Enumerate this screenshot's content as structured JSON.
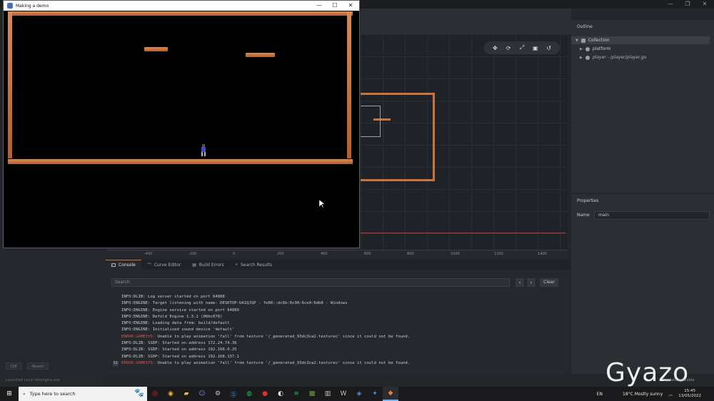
{
  "game_window": {
    "title": "Making a demo",
    "controls": {
      "minimize": "—",
      "maximize": "☐",
      "close": "✕"
    }
  },
  "editor": {
    "window_controls": {
      "minimize": "—",
      "restore": "❐",
      "close": "✕"
    },
    "scene_tools": [
      "move-tool-icon",
      "rotate-tool-icon",
      "scale-tool-icon",
      "camera-tool-icon",
      "reset-tool-icon"
    ],
    "ruler_ticks": [
      "-400",
      "-200",
      "0",
      "200",
      "400",
      "600",
      "800",
      "1000",
      "1200",
      "1400"
    ]
  },
  "outline": {
    "title": "Outline",
    "items": [
      {
        "label": "Collection",
        "depth": 0,
        "expanded": true,
        "selected": true
      },
      {
        "label": "platform",
        "depth": 1,
        "expanded": false,
        "selected": false
      },
      {
        "label": "player - /player/player.go",
        "depth": 1,
        "expanded": false,
        "selected": false
      }
    ]
  },
  "properties": {
    "title": "Properties",
    "name_label": "Name",
    "name_value": "main"
  },
  "left_panel": {
    "diff_label": "Diff",
    "revert_label": "Revert",
    "status": "Launched Local dmengine.exe"
  },
  "bottom_tabs": [
    {
      "label": "Console",
      "icon": "console-icon",
      "active": true
    },
    {
      "label": "Curve Editor",
      "icon": "curve-icon",
      "active": false
    },
    {
      "label": "Build Errors",
      "icon": "build-errors-icon",
      "active": false
    },
    {
      "label": "Search Results",
      "icon": "search-icon",
      "active": false
    }
  ],
  "console": {
    "search_placeholder": "Search",
    "prev_label": "‹",
    "next_label": "›",
    "clear_label": "Clear",
    "lines": [
      {
        "prefix": "INFO:DLIB:",
        "text": " Log server started on port 64888",
        "error": false,
        "count": ""
      },
      {
        "prefix": "INFO:ENGINE:",
        "text": " Target listening with name: DESKTOP-UA1QJQP - fe80::dc6b:0c90:6ce4:6db0 - Windows",
        "error": false,
        "count": ""
      },
      {
        "prefix": "INFO:ENGINE:",
        "text": " Engine service started on port 64889",
        "error": false,
        "count": ""
      },
      {
        "prefix": "INFO:ENGINE:",
        "text": " Defold Engine 1.3.1 (06bc078)",
        "error": false,
        "count": ""
      },
      {
        "prefix": "INFO:ENGINE:",
        "text": " Loading data from: build/default",
        "error": false,
        "count": ""
      },
      {
        "prefix": "INFO:ENGINE:",
        "text": " Initialised sound device 'default'",
        "error": false,
        "count": ""
      },
      {
        "prefix": "ERROR:GAMESYS:",
        "text": " Unable to play animation 'fall' from texture '/_generated_93dc3ca2.texturec' since it could not be found.",
        "error": true,
        "count": ""
      },
      {
        "prefix": "INFO:DLIB:",
        "text": " SSDP: Started on address 172.24.74.36",
        "error": false,
        "count": ""
      },
      {
        "prefix": "INFO:DLIB:",
        "text": " SSDP: Started on address 192.168.0.25",
        "error": false,
        "count": ""
      },
      {
        "prefix": "INFO:DLIB:",
        "text": " SSDP: Started on address 192.168.137.1",
        "error": false,
        "count": ""
      },
      {
        "prefix": "ERROR:GAMESYS:",
        "text": " Unable to play animation 'fall' from texture '/_generated_93dc3ca2.texturec' since it could not be found.",
        "error": true,
        "count": "51"
      }
    ]
  },
  "taskbar": {
    "search_placeholder": "Type here to search",
    "language": "EN",
    "weather": "18°C  Mostly sunny",
    "time": "15:45",
    "date": "13/05/2022",
    "apps": [
      "opera-icon",
      "chrome-icon",
      "file-explorer-icon",
      "discord-icon",
      "steam-icon",
      "skype-icon",
      "spotify-app-icon",
      "record-icon",
      "github-icon",
      "spotify-icon",
      "minecraft-icon",
      "editor-icon",
      "word-icon",
      "controller-icon",
      "chrome-blue-icon",
      "defold-icon"
    ]
  },
  "watermark": {
    "logo": "Gyazo",
    "caption": "Update available"
  }
}
